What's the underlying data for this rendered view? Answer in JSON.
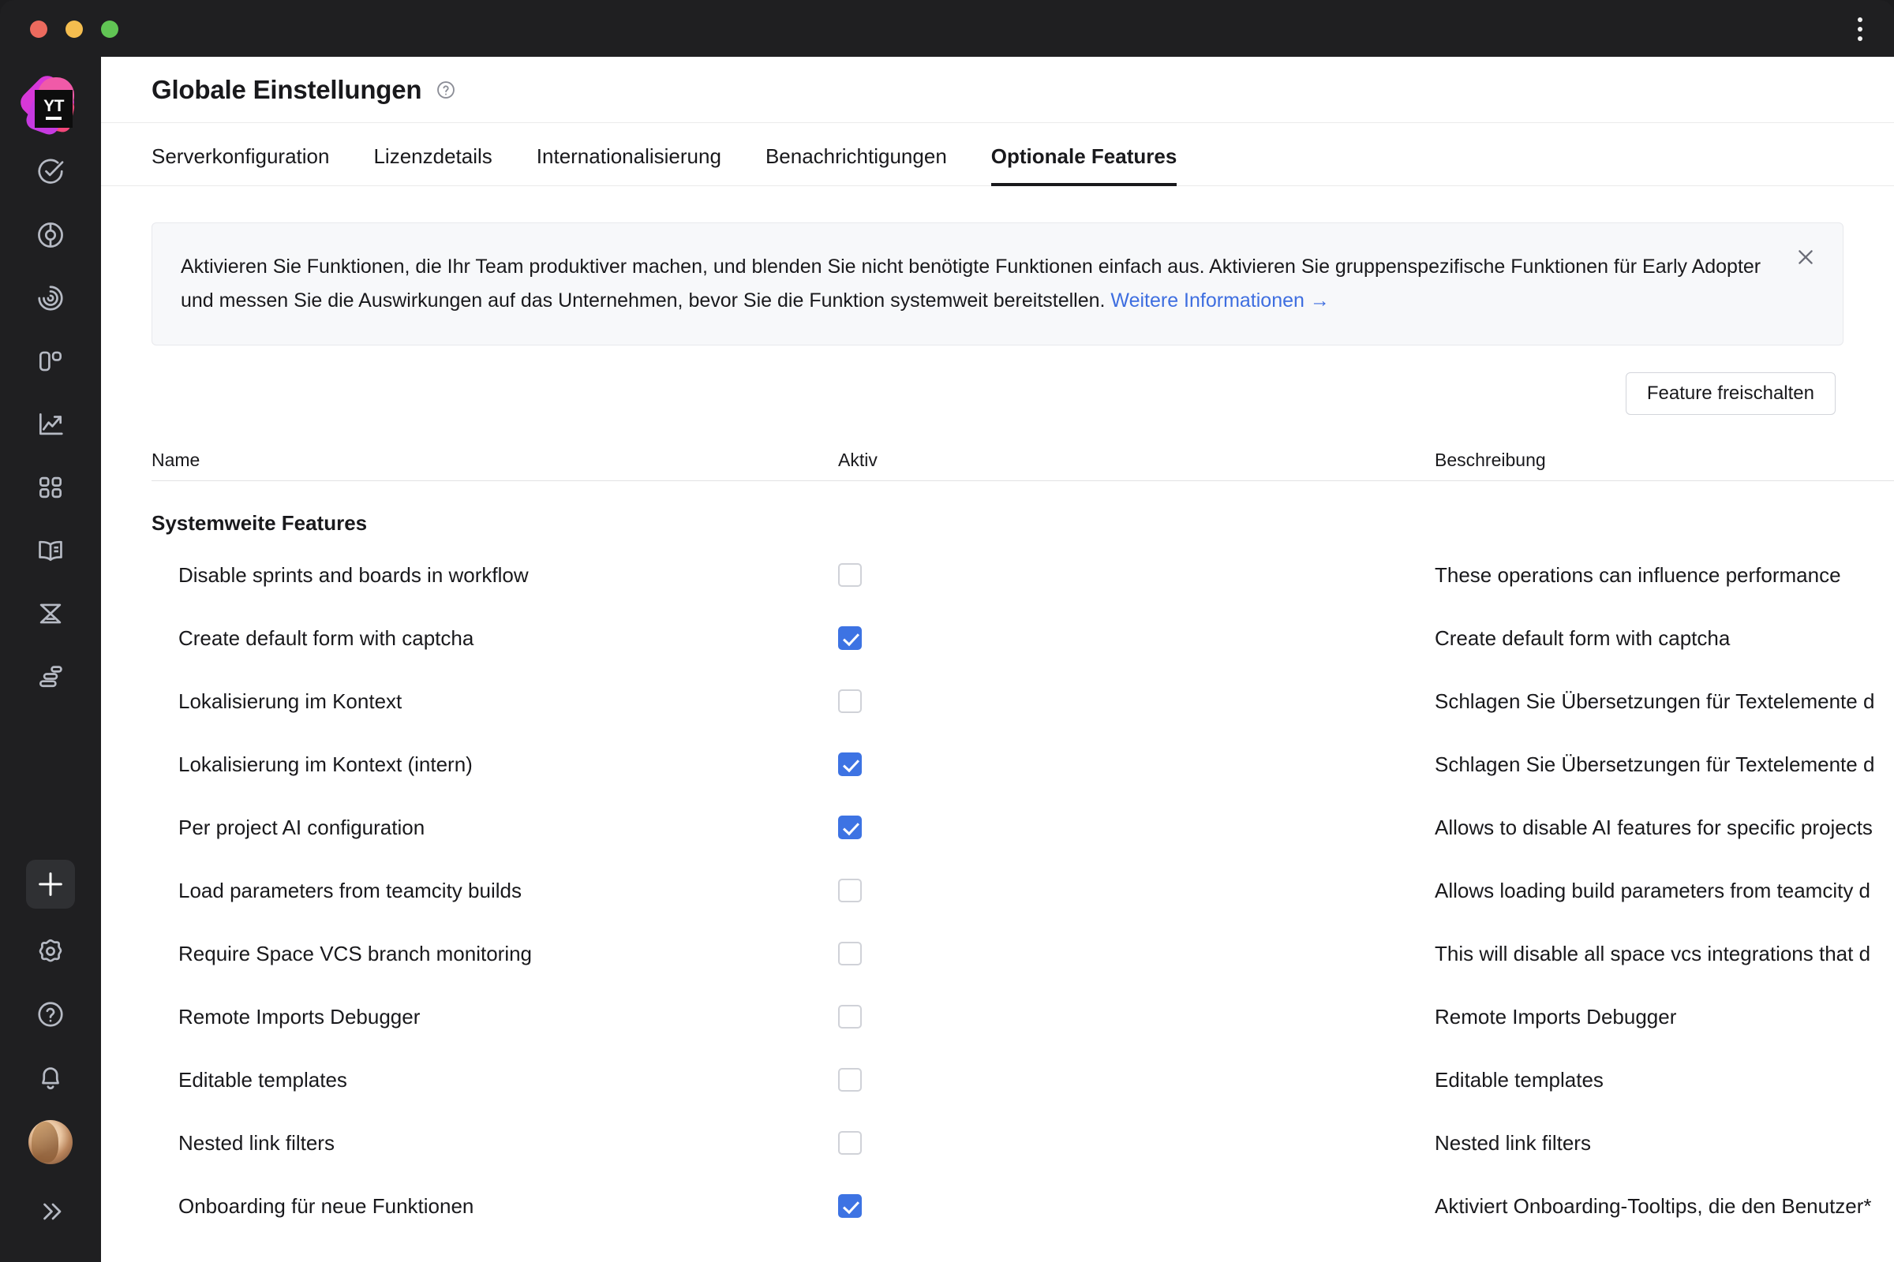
{
  "window": {
    "menu_icon": "kebab-menu-icon",
    "traffic_lights": [
      "close",
      "minimize",
      "maximize"
    ]
  },
  "sidebar": {
    "logo_text": "YT",
    "items": [
      {
        "icon": "check-circle-icon",
        "name": "issues"
      },
      {
        "icon": "agile-boards-icon",
        "name": "agile-boards"
      },
      {
        "icon": "radar-icon",
        "name": "dashboards"
      },
      {
        "icon": "kanban-columns-icon",
        "name": "boards"
      },
      {
        "icon": "chart-growth-icon",
        "name": "reports"
      },
      {
        "icon": "grid-apps-icon",
        "name": "apps"
      },
      {
        "icon": "knowledge-book-icon",
        "name": "knowledge-base"
      },
      {
        "icon": "hourglass-icon",
        "name": "time-tracking"
      },
      {
        "icon": "gantt-list-icon",
        "name": "gantt"
      }
    ],
    "bottom_items": [
      {
        "icon": "plus-icon",
        "name": "create"
      },
      {
        "icon": "gear-icon",
        "name": "settings"
      },
      {
        "icon": "help-circle-icon",
        "name": "help"
      },
      {
        "icon": "bell-icon",
        "name": "notifications"
      },
      {
        "icon": "avatar",
        "name": "user-avatar"
      },
      {
        "icon": "chevrons-right-icon",
        "name": "expand-sidebar"
      }
    ]
  },
  "header": {
    "title": "Globale Einstellungen",
    "help_icon": "question-circle-icon"
  },
  "tabs": [
    {
      "label": "Serverkonfiguration",
      "selected": false
    },
    {
      "label": "Lizenzdetails",
      "selected": false
    },
    {
      "label": "Internationalisierung",
      "selected": false
    },
    {
      "label": "Benachrichtigungen",
      "selected": false
    },
    {
      "label": "Optionale Features",
      "selected": true
    }
  ],
  "banner": {
    "text": "Aktivieren Sie Funktionen, die Ihr Team produktiver machen, und blenden Sie nicht benötigte Funktionen einfach aus. Aktivieren Sie gruppenspezifische Funktionen für Early Adopter und messen Sie die Auswirkungen auf das Unternehmen, bevor Sie die Funktion systemweit bereitstellen. ",
    "link_label": "Weitere Informationen →",
    "close_icon": "close-icon"
  },
  "toolbar": {
    "unlock_feature_label": "Feature freischalten"
  },
  "table": {
    "columns": {
      "name": "Name",
      "active": "Aktiv",
      "description": "Beschreibung"
    },
    "group_title": "Systemweite Features",
    "rows": [
      {
        "name": "Disable sprints and boards in workflow",
        "active": false,
        "description": "These operations can influence performance"
      },
      {
        "name": "Create default form with captcha",
        "active": true,
        "description": "Create default form with captcha"
      },
      {
        "name": "Lokalisierung im Kontext",
        "active": false,
        "description": "Schlagen Sie Übersetzungen für Textelemente d"
      },
      {
        "name": "Lokalisierung im Kontext (intern)",
        "active": true,
        "description": "Schlagen Sie Übersetzungen für Textelemente d"
      },
      {
        "name": "Per project AI configuration",
        "active": true,
        "description": "Allows to disable AI features for specific projects"
      },
      {
        "name": "Load parameters from teamcity builds",
        "active": false,
        "description": "Allows loading build parameters from teamcity d"
      },
      {
        "name": "Require Space VCS branch monitoring",
        "active": false,
        "description": "This will disable all space vcs integrations that d"
      },
      {
        "name": "Remote Imports Debugger",
        "active": false,
        "description": "Remote Imports Debugger"
      },
      {
        "name": "Editable templates",
        "active": false,
        "description": "Editable templates"
      },
      {
        "name": "Nested link filters",
        "active": false,
        "description": "Nested link filters"
      },
      {
        "name": "Onboarding für neue Funktionen",
        "active": true,
        "description": "Aktiviert Onboarding-Tooltips, die den Benutzer*"
      }
    ]
  },
  "colors": {
    "accent": "#3d73e3",
    "link": "#3e6ee0",
    "sidebar_bg": "#1f1f21",
    "banner_bg": "#f7f8fa"
  }
}
